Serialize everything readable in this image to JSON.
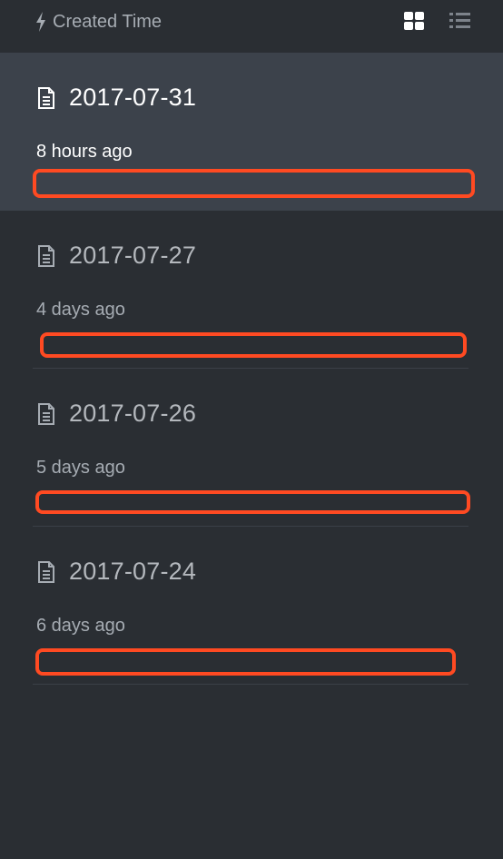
{
  "toolbar": {
    "sort_label": "Created Time",
    "sort_icon": "bolt-icon",
    "view_grid_icon": "grid-view-icon",
    "view_list_icon": "list-view-icon"
  },
  "notes": [
    {
      "title": "2017-07-31",
      "time": "8 hours ago",
      "active": true
    },
    {
      "title": "2017-07-27",
      "time": "4 days ago",
      "active": false
    },
    {
      "title": "2017-07-26",
      "time": "5 days ago",
      "active": false
    },
    {
      "title": "2017-07-24",
      "time": "6 days ago",
      "active": false
    }
  ],
  "colors": {
    "background": "#2a2e33",
    "active_item": "#3c424b",
    "highlight_box": "#ff4a22"
  }
}
